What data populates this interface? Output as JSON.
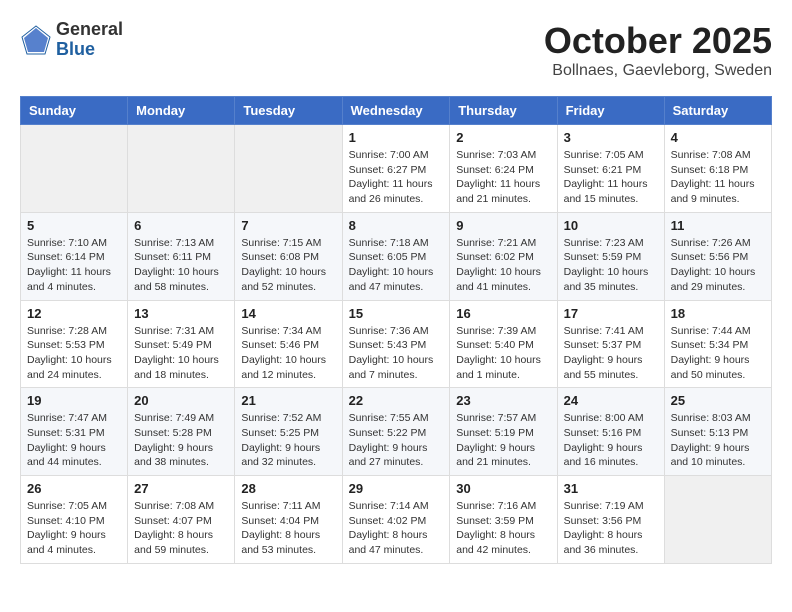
{
  "header": {
    "logo_general": "General",
    "logo_blue": "Blue",
    "month_title": "October 2025",
    "location": "Bollnaes, Gaevleborg, Sweden"
  },
  "weekdays": [
    "Sunday",
    "Monday",
    "Tuesday",
    "Wednesday",
    "Thursday",
    "Friday",
    "Saturday"
  ],
  "weeks": [
    [
      {
        "day": "",
        "sunrise": "",
        "sunset": "",
        "daylight": ""
      },
      {
        "day": "",
        "sunrise": "",
        "sunset": "",
        "daylight": ""
      },
      {
        "day": "",
        "sunrise": "",
        "sunset": "",
        "daylight": ""
      },
      {
        "day": "1",
        "sunrise": "Sunrise: 7:00 AM",
        "sunset": "Sunset: 6:27 PM",
        "daylight": "Daylight: 11 hours and 26 minutes."
      },
      {
        "day": "2",
        "sunrise": "Sunrise: 7:03 AM",
        "sunset": "Sunset: 6:24 PM",
        "daylight": "Daylight: 11 hours and 21 minutes."
      },
      {
        "day": "3",
        "sunrise": "Sunrise: 7:05 AM",
        "sunset": "Sunset: 6:21 PM",
        "daylight": "Daylight: 11 hours and 15 minutes."
      },
      {
        "day": "4",
        "sunrise": "Sunrise: 7:08 AM",
        "sunset": "Sunset: 6:18 PM",
        "daylight": "Daylight: 11 hours and 9 minutes."
      }
    ],
    [
      {
        "day": "5",
        "sunrise": "Sunrise: 7:10 AM",
        "sunset": "Sunset: 6:14 PM",
        "daylight": "Daylight: 11 hours and 4 minutes."
      },
      {
        "day": "6",
        "sunrise": "Sunrise: 7:13 AM",
        "sunset": "Sunset: 6:11 PM",
        "daylight": "Daylight: 10 hours and 58 minutes."
      },
      {
        "day": "7",
        "sunrise": "Sunrise: 7:15 AM",
        "sunset": "Sunset: 6:08 PM",
        "daylight": "Daylight: 10 hours and 52 minutes."
      },
      {
        "day": "8",
        "sunrise": "Sunrise: 7:18 AM",
        "sunset": "Sunset: 6:05 PM",
        "daylight": "Daylight: 10 hours and 47 minutes."
      },
      {
        "day": "9",
        "sunrise": "Sunrise: 7:21 AM",
        "sunset": "Sunset: 6:02 PM",
        "daylight": "Daylight: 10 hours and 41 minutes."
      },
      {
        "day": "10",
        "sunrise": "Sunrise: 7:23 AM",
        "sunset": "Sunset: 5:59 PM",
        "daylight": "Daylight: 10 hours and 35 minutes."
      },
      {
        "day": "11",
        "sunrise": "Sunrise: 7:26 AM",
        "sunset": "Sunset: 5:56 PM",
        "daylight": "Daylight: 10 hours and 29 minutes."
      }
    ],
    [
      {
        "day": "12",
        "sunrise": "Sunrise: 7:28 AM",
        "sunset": "Sunset: 5:53 PM",
        "daylight": "Daylight: 10 hours and 24 minutes."
      },
      {
        "day": "13",
        "sunrise": "Sunrise: 7:31 AM",
        "sunset": "Sunset: 5:49 PM",
        "daylight": "Daylight: 10 hours and 18 minutes."
      },
      {
        "day": "14",
        "sunrise": "Sunrise: 7:34 AM",
        "sunset": "Sunset: 5:46 PM",
        "daylight": "Daylight: 10 hours and 12 minutes."
      },
      {
        "day": "15",
        "sunrise": "Sunrise: 7:36 AM",
        "sunset": "Sunset: 5:43 PM",
        "daylight": "Daylight: 10 hours and 7 minutes."
      },
      {
        "day": "16",
        "sunrise": "Sunrise: 7:39 AM",
        "sunset": "Sunset: 5:40 PM",
        "daylight": "Daylight: 10 hours and 1 minute."
      },
      {
        "day": "17",
        "sunrise": "Sunrise: 7:41 AM",
        "sunset": "Sunset: 5:37 PM",
        "daylight": "Daylight: 9 hours and 55 minutes."
      },
      {
        "day": "18",
        "sunrise": "Sunrise: 7:44 AM",
        "sunset": "Sunset: 5:34 PM",
        "daylight": "Daylight: 9 hours and 50 minutes."
      }
    ],
    [
      {
        "day": "19",
        "sunrise": "Sunrise: 7:47 AM",
        "sunset": "Sunset: 5:31 PM",
        "daylight": "Daylight: 9 hours and 44 minutes."
      },
      {
        "day": "20",
        "sunrise": "Sunrise: 7:49 AM",
        "sunset": "Sunset: 5:28 PM",
        "daylight": "Daylight: 9 hours and 38 minutes."
      },
      {
        "day": "21",
        "sunrise": "Sunrise: 7:52 AM",
        "sunset": "Sunset: 5:25 PM",
        "daylight": "Daylight: 9 hours and 32 minutes."
      },
      {
        "day": "22",
        "sunrise": "Sunrise: 7:55 AM",
        "sunset": "Sunset: 5:22 PM",
        "daylight": "Daylight: 9 hours and 27 minutes."
      },
      {
        "day": "23",
        "sunrise": "Sunrise: 7:57 AM",
        "sunset": "Sunset: 5:19 PM",
        "daylight": "Daylight: 9 hours and 21 minutes."
      },
      {
        "day": "24",
        "sunrise": "Sunrise: 8:00 AM",
        "sunset": "Sunset: 5:16 PM",
        "daylight": "Daylight: 9 hours and 16 minutes."
      },
      {
        "day": "25",
        "sunrise": "Sunrise: 8:03 AM",
        "sunset": "Sunset: 5:13 PM",
        "daylight": "Daylight: 9 hours and 10 minutes."
      }
    ],
    [
      {
        "day": "26",
        "sunrise": "Sunrise: 7:05 AM",
        "sunset": "Sunset: 4:10 PM",
        "daylight": "Daylight: 9 hours and 4 minutes."
      },
      {
        "day": "27",
        "sunrise": "Sunrise: 7:08 AM",
        "sunset": "Sunset: 4:07 PM",
        "daylight": "Daylight: 8 hours and 59 minutes."
      },
      {
        "day": "28",
        "sunrise": "Sunrise: 7:11 AM",
        "sunset": "Sunset: 4:04 PM",
        "daylight": "Daylight: 8 hours and 53 minutes."
      },
      {
        "day": "29",
        "sunrise": "Sunrise: 7:14 AM",
        "sunset": "Sunset: 4:02 PM",
        "daylight": "Daylight: 8 hours and 47 minutes."
      },
      {
        "day": "30",
        "sunrise": "Sunrise: 7:16 AM",
        "sunset": "Sunset: 3:59 PM",
        "daylight": "Daylight: 8 hours and 42 minutes."
      },
      {
        "day": "31",
        "sunrise": "Sunrise: 7:19 AM",
        "sunset": "Sunset: 3:56 PM",
        "daylight": "Daylight: 8 hours and 36 minutes."
      },
      {
        "day": "",
        "sunrise": "",
        "sunset": "",
        "daylight": ""
      }
    ]
  ]
}
